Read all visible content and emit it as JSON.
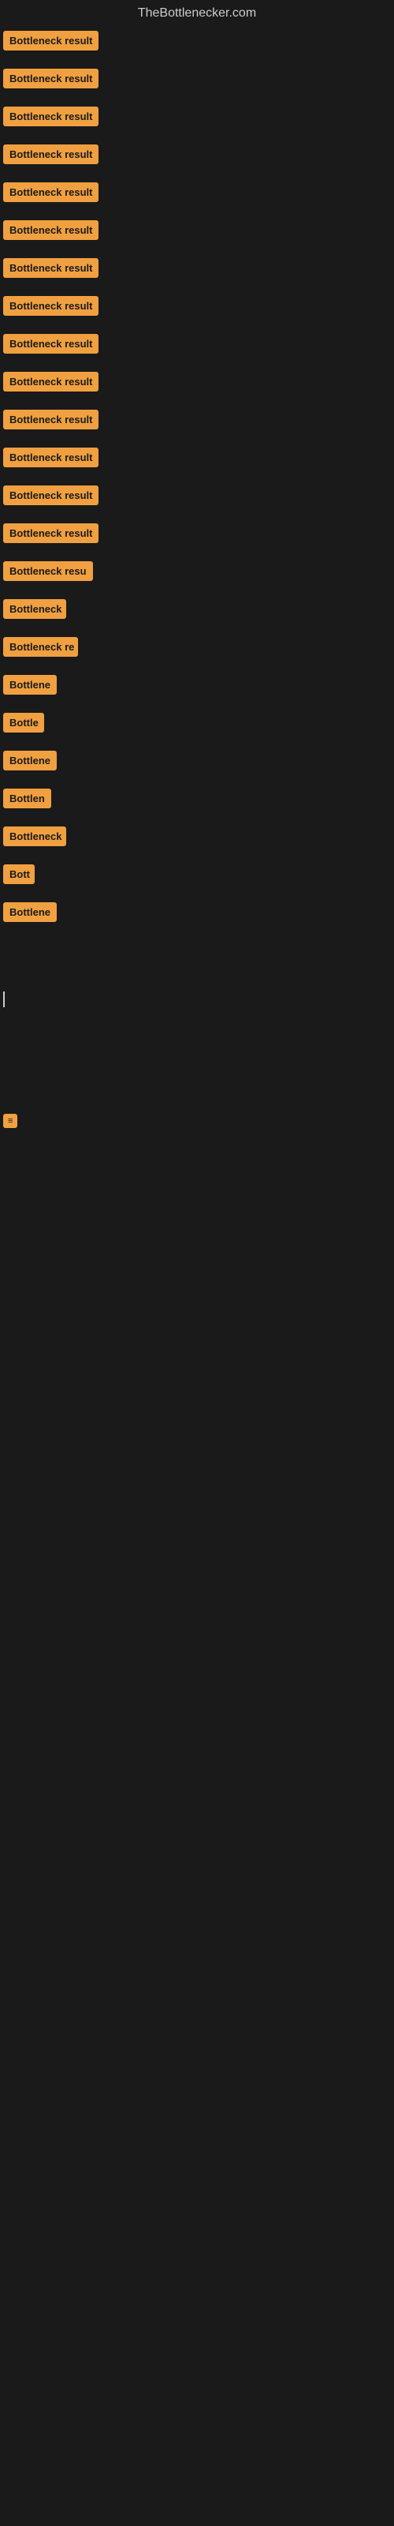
{
  "site": {
    "title": "TheBottlenecker.com"
  },
  "items": [
    {
      "label": "Bottleneck result",
      "width": 130
    },
    {
      "label": "Bottleneck result",
      "width": 130
    },
    {
      "label": "Bottleneck result",
      "width": 130
    },
    {
      "label": "Bottleneck result",
      "width": 130
    },
    {
      "label": "Bottleneck result",
      "width": 130
    },
    {
      "label": "Bottleneck result",
      "width": 130
    },
    {
      "label": "Bottleneck result",
      "width": 130
    },
    {
      "label": "Bottleneck result",
      "width": 130
    },
    {
      "label": "Bottleneck result",
      "width": 130
    },
    {
      "label": "Bottleneck result",
      "width": 130
    },
    {
      "label": "Bottleneck result",
      "width": 130
    },
    {
      "label": "Bottleneck result",
      "width": 130
    },
    {
      "label": "Bottleneck result",
      "width": 130
    },
    {
      "label": "Bottleneck result",
      "width": 130
    },
    {
      "label": "Bottleneck resu",
      "width": 115
    },
    {
      "label": "Bottleneck",
      "width": 80
    },
    {
      "label": "Bottleneck re",
      "width": 95
    },
    {
      "label": "Bottlene",
      "width": 70
    },
    {
      "label": "Bottle",
      "width": 52
    },
    {
      "label": "Bottlene",
      "width": 70
    },
    {
      "label": "Bottlen",
      "width": 62
    },
    {
      "label": "Bottleneck",
      "width": 80
    },
    {
      "label": "Bott",
      "width": 40
    },
    {
      "label": "Bottlene",
      "width": 70
    }
  ],
  "colors": {
    "badge_bg": "#f0a040",
    "badge_text": "#1a1a1a",
    "background": "#1a1a1a",
    "title": "#cccccc"
  }
}
